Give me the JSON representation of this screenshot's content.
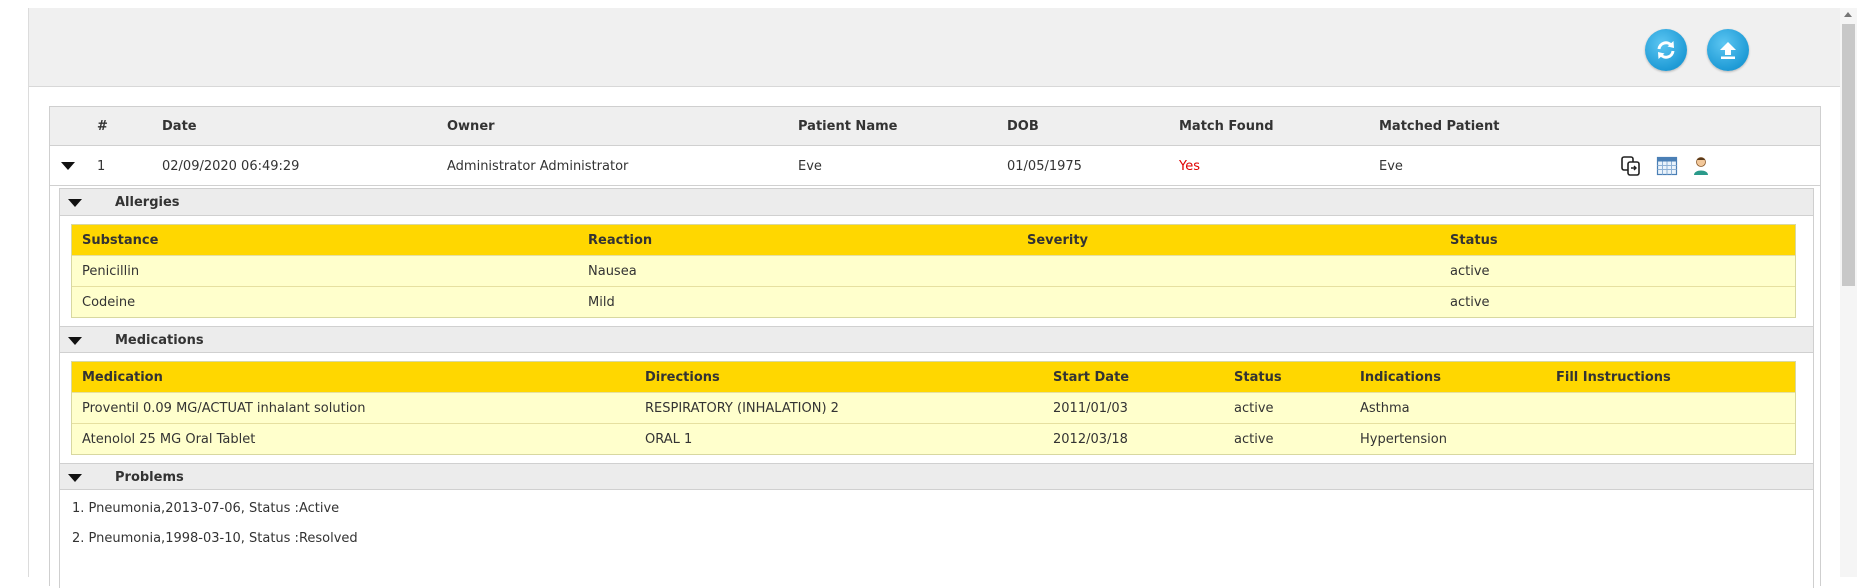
{
  "toolbar": {
    "refresh_icon": "refresh-icon",
    "upload_icon": "upload-icon",
    "accent": "#1f9bd6"
  },
  "grid": {
    "headers": [
      "#",
      "Date",
      "Owner",
      "Patient Name",
      "DOB",
      "Match Found",
      "Matched Patient"
    ],
    "row": {
      "num": "1",
      "date": "02/09/2020 06:49:29",
      "owner": "Administrator Administrator",
      "patient_name": "Eve",
      "dob": "01/05/1975",
      "match_found": "Yes",
      "matched_patient": "Eve",
      "match_color": "#e00000",
      "action_icons": [
        "copy-record-icon",
        "calendar-grid-icon",
        "patient-user-icon"
      ]
    }
  },
  "allergies": {
    "title": "Allergies",
    "headers": [
      "Substance",
      "Reaction",
      "Severity",
      "Status"
    ],
    "rows": [
      [
        "Penicillin",
        "Nausea",
        "",
        "active"
      ],
      [
        "Codeine",
        "Mild",
        "",
        "active"
      ]
    ]
  },
  "medications": {
    "title": "Medications",
    "headers": [
      "Medication",
      "Directions",
      "Start Date",
      "Status",
      "Indications",
      "Fill Instructions"
    ],
    "rows": [
      [
        "Proventil 0.09 MG/ACTUAT inhalant solution",
        "RESPIRATORY (INHALATION) 2",
        "2011/01/03",
        "active",
        "Asthma",
        ""
      ],
      [
        "Atenolol 25 MG Oral Tablet",
        "ORAL 1",
        "2012/03/18",
        "active",
        "Hypertension",
        ""
      ]
    ]
  },
  "problems": {
    "title": "Problems",
    "items": [
      "1. Pneumonia,2013-07-06, Status :Active",
      "2. Pneumonia,1998-03-10, Status :Resolved"
    ]
  },
  "colors": {
    "table_header": "#ffd700",
    "table_row": "#ffffcc"
  }
}
